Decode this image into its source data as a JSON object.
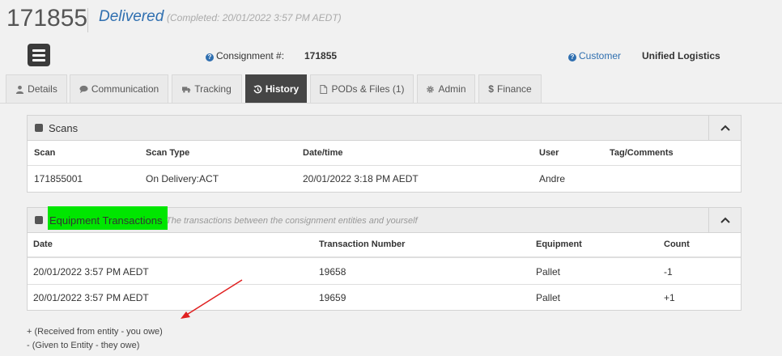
{
  "header": {
    "consignment_number": "171855",
    "status": "Delivered",
    "completed_text": "(Completed: 20/01/2022 3:57 PM AEDT)",
    "consignment_label": "Consignment #:",
    "consignment_value": "171855",
    "customer_label": "Customer",
    "customer_value": "Unified Logistics"
  },
  "tabs": [
    {
      "label": "Details",
      "icon": "user-icon"
    },
    {
      "label": "Communication",
      "icon": "comment-icon"
    },
    {
      "label": "Tracking",
      "icon": "truck-icon"
    },
    {
      "label": "History",
      "icon": "history-icon",
      "active": true
    },
    {
      "label": "PODs & Files (1)",
      "icon": "file-icon"
    },
    {
      "label": "Admin",
      "icon": "gear-icon"
    },
    {
      "label": "Finance",
      "icon": "dollar-icon"
    }
  ],
  "scans": {
    "title": "Scans",
    "columns": [
      "Scan",
      "Scan Type",
      "Date/time",
      "User",
      "Tag/Comments"
    ],
    "rows": [
      [
        "171855001",
        "On Delivery:ACT",
        "20/01/2022 3:18 PM AEDT",
        "Andre",
        ""
      ]
    ]
  },
  "equipment": {
    "title": "Equipment Transactions",
    "subtitle": "The transactions between the consignment entities and yourself",
    "title_highlight": "#00e600",
    "columns": [
      "Date",
      "Transaction Number",
      "Equipment",
      "Count"
    ],
    "rows": [
      [
        "20/01/2022 3:57 PM AEDT",
        "19658",
        "Pallet",
        "-1"
      ],
      [
        "20/01/2022 3:57 PM AEDT",
        "19659",
        "Pallet",
        "+1"
      ]
    ]
  },
  "legend": {
    "plus": "+ (Received from entity - you owe)",
    "minus": "- (Given to Entity - they owe)"
  },
  "colors": {
    "accent": "#2f6fb0",
    "active_tab": "#454545",
    "arrow": "#e02020"
  }
}
